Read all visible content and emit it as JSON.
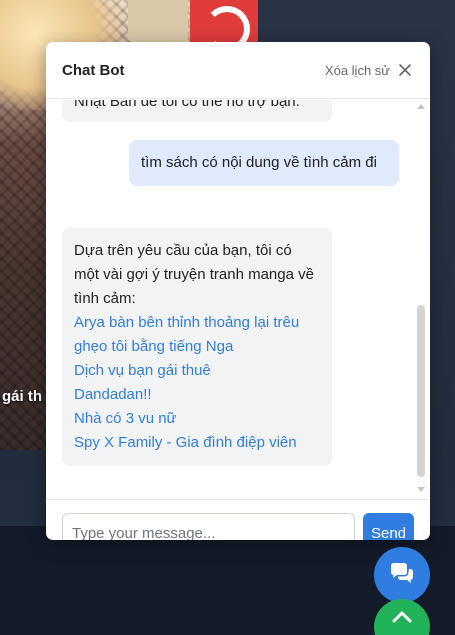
{
  "background": {
    "manga_title_partial": "gái th"
  },
  "chat": {
    "title": "Chat Bot",
    "clear_history": "Xóa lịch sử",
    "close_icon": "close-icon",
    "messages": [
      {
        "role": "bot",
        "text": "Nhật Bản để tôi có thể hỗ trợ bạn."
      },
      {
        "role": "user",
        "text": "tìm sách có nội dung về tình cảm đi"
      },
      {
        "role": "bot",
        "intro": "Dựa trên yêu cầu của bạn, tôi có một vài gợi ý truyện tranh manga về tình cảm:",
        "links": [
          "Arya bàn bên thỉnh thoảng lại trêu ghẹo tôi bằng tiếng Nga",
          "Dịch vụ bạn gái thuê",
          "Dandadan!!",
          "Nhà có 3 vu nữ",
          "Spy X Family - Gia đình điệp viên"
        ]
      }
    ],
    "input_placeholder": "Type your message...",
    "input_value": "",
    "send_label": "Send"
  },
  "fabs": {
    "chat_icon": "chat-bubbles-icon",
    "top_icon": "chevron-up-icon"
  },
  "colors": {
    "accent": "#2f7de1",
    "user_bubble": "#dfeafd",
    "bot_bubble": "#f1f3f5",
    "link": "#2f7de1",
    "scroll_top_fab": "#22b35a"
  }
}
